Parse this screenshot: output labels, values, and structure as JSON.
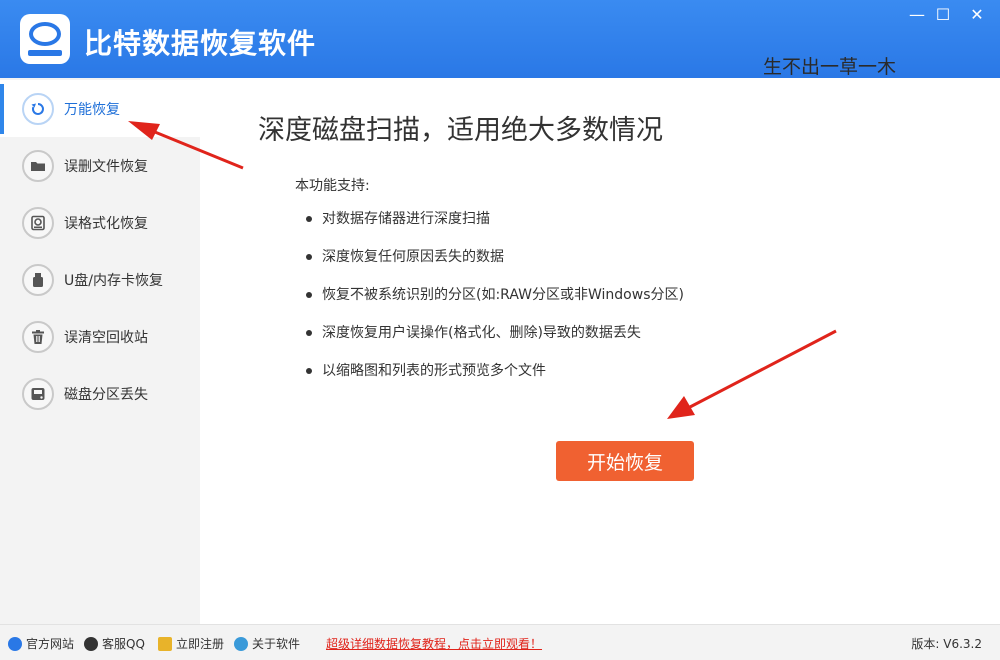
{
  "header": {
    "app_title": "比特数据恢复软件",
    "watermark": "生不出一草一木",
    "controls": {
      "minimize": "—",
      "maximize": "☐",
      "close": "✕"
    }
  },
  "sidebar": {
    "items": [
      {
        "label": "万能恢复",
        "icon": "refresh-icon",
        "active": true
      },
      {
        "label": "误删文件恢复",
        "icon": "folder-icon",
        "active": false
      },
      {
        "label": "误格式化恢复",
        "icon": "format-disk-icon",
        "active": false
      },
      {
        "label": "U盘/内存卡恢复",
        "icon": "usb-icon",
        "active": false
      },
      {
        "label": "误清空回收站",
        "icon": "trash-icon",
        "active": false
      },
      {
        "label": "磁盘分区丢失",
        "icon": "disk-icon",
        "active": false
      }
    ]
  },
  "main": {
    "headline": "深度磁盘扫描，适用绝大多数情况",
    "support_label": "本功能支持:",
    "features": [
      "对数据存储器进行深度扫描",
      "深度恢复任何原因丢失的数据",
      "恢复不被系统识别的分区(如:RAW分区或非Windows分区)",
      "深度恢复用户误操作(格式化、删除)导致的数据丢失",
      "以缩略图和列表的形式预览多个文件"
    ],
    "start_button": "开始恢复"
  },
  "footer": {
    "links": [
      {
        "label": "官方网站",
        "icon": "ie-icon"
      },
      {
        "label": "客服QQ",
        "icon": "qq-icon"
      },
      {
        "label": "立即注册",
        "icon": "key-icon"
      },
      {
        "label": "关于软件",
        "icon": "info-icon"
      }
    ],
    "promo": "超级详细数据恢复教程，点击立即观看！",
    "version": "版本: V6.3.2"
  },
  "colors": {
    "accent": "#2a78e6",
    "button": "#f06131",
    "annotation_arrow": "#e0241b"
  }
}
